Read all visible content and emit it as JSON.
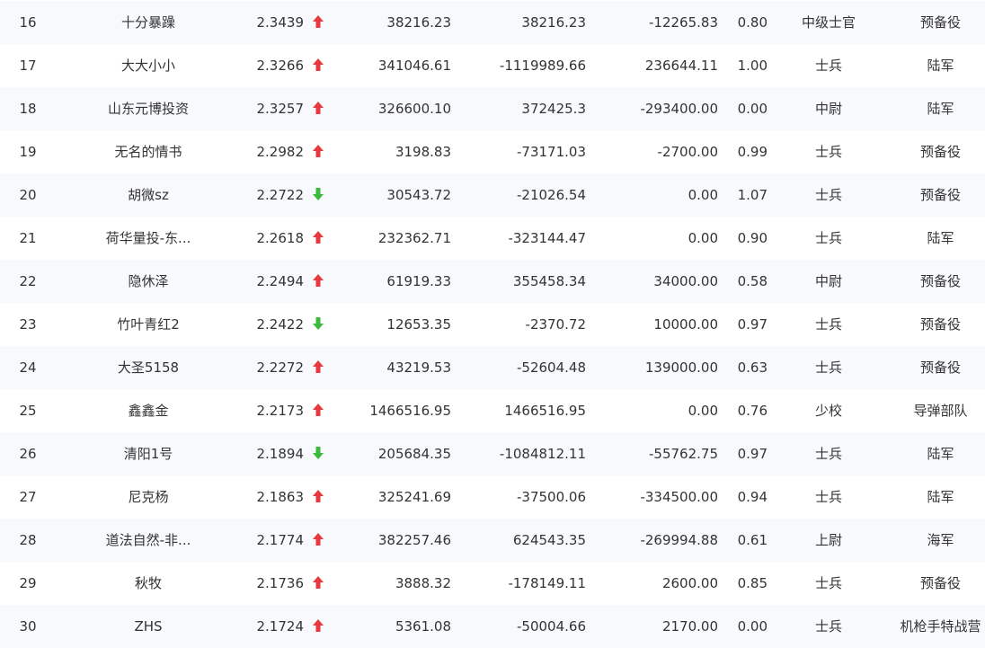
{
  "colors": {
    "up_arrow": "#e8383d",
    "down_arrow": "#3cba3c",
    "row_alt_bg": "#f7f9fc",
    "text": "#333333"
  },
  "table": {
    "rows": [
      {
        "rank": "16",
        "name": "十分暴躁",
        "score": "2.3439",
        "trend": "up",
        "v1": "38216.23",
        "v2": "38216.23",
        "v3": "-12265.83",
        "ratio": "0.80",
        "military_rank": "中级士官",
        "branch": "预备役"
      },
      {
        "rank": "17",
        "name": "大大小小",
        "score": "2.3266",
        "trend": "up",
        "v1": "341046.61",
        "v2": "-1119989.66",
        "v3": "236644.11",
        "ratio": "1.00",
        "military_rank": "士兵",
        "branch": "陆军"
      },
      {
        "rank": "18",
        "name": "山东元博投资",
        "score": "2.3257",
        "trend": "up",
        "v1": "326600.10",
        "v2": "372425.3",
        "v3": "-293400.00",
        "ratio": "0.00",
        "military_rank": "中尉",
        "branch": "陆军"
      },
      {
        "rank": "19",
        "name": "无名的情书",
        "score": "2.2982",
        "trend": "up",
        "v1": "3198.83",
        "v2": "-73171.03",
        "v3": "-2700.00",
        "ratio": "0.99",
        "military_rank": "士兵",
        "branch": "预备役"
      },
      {
        "rank": "20",
        "name": "胡微sz",
        "score": "2.2722",
        "trend": "down",
        "v1": "30543.72",
        "v2": "-21026.54",
        "v3": "0.00",
        "ratio": "1.07",
        "military_rank": "士兵",
        "branch": "预备役"
      },
      {
        "rank": "21",
        "name": "荷华量投-东...",
        "score": "2.2618",
        "trend": "up",
        "v1": "232362.71",
        "v2": "-323144.47",
        "v3": "0.00",
        "ratio": "0.90",
        "military_rank": "士兵",
        "branch": "陆军"
      },
      {
        "rank": "22",
        "name": "隐休泽",
        "score": "2.2494",
        "trend": "up",
        "v1": "61919.33",
        "v2": "355458.34",
        "v3": "34000.00",
        "ratio": "0.58",
        "military_rank": "中尉",
        "branch": "预备役"
      },
      {
        "rank": "23",
        "name": "竹叶青红2",
        "score": "2.2422",
        "trend": "down",
        "v1": "12653.35",
        "v2": "-2370.72",
        "v3": "10000.00",
        "ratio": "0.97",
        "military_rank": "士兵",
        "branch": "预备役"
      },
      {
        "rank": "24",
        "name": "大圣5158",
        "score": "2.2272",
        "trend": "up",
        "v1": "43219.53",
        "v2": "-52604.48",
        "v3": "139000.00",
        "ratio": "0.63",
        "military_rank": "士兵",
        "branch": "预备役"
      },
      {
        "rank": "25",
        "name": "鑫鑫金",
        "score": "2.2173",
        "trend": "up",
        "v1": "1466516.95",
        "v2": "1466516.95",
        "v3": "0.00",
        "ratio": "0.76",
        "military_rank": "少校",
        "branch": "导弹部队"
      },
      {
        "rank": "26",
        "name": "清阳1号",
        "score": "2.1894",
        "trend": "down",
        "v1": "205684.35",
        "v2": "-1084812.11",
        "v3": "-55762.75",
        "ratio": "0.97",
        "military_rank": "士兵",
        "branch": "陆军"
      },
      {
        "rank": "27",
        "name": "尼克杨",
        "score": "2.1863",
        "trend": "up",
        "v1": "325241.69",
        "v2": "-37500.06",
        "v3": "-334500.00",
        "ratio": "0.94",
        "military_rank": "士兵",
        "branch": "陆军"
      },
      {
        "rank": "28",
        "name": "道法自然-非...",
        "score": "2.1774",
        "trend": "up",
        "v1": "382257.46",
        "v2": "624543.35",
        "v3": "-269994.88",
        "ratio": "0.61",
        "military_rank": "上尉",
        "branch": "海军"
      },
      {
        "rank": "29",
        "name": "秋牧",
        "score": "2.1736",
        "trend": "up",
        "v1": "3888.32",
        "v2": "-178149.11",
        "v3": "2600.00",
        "ratio": "0.85",
        "military_rank": "士兵",
        "branch": "预备役"
      },
      {
        "rank": "30",
        "name": "ZHS",
        "score": "2.1724",
        "trend": "up",
        "v1": "5361.08",
        "v2": "-50004.66",
        "v3": "2170.00",
        "ratio": "0.00",
        "military_rank": "士兵",
        "branch": "机枪手特战营"
      }
    ]
  }
}
